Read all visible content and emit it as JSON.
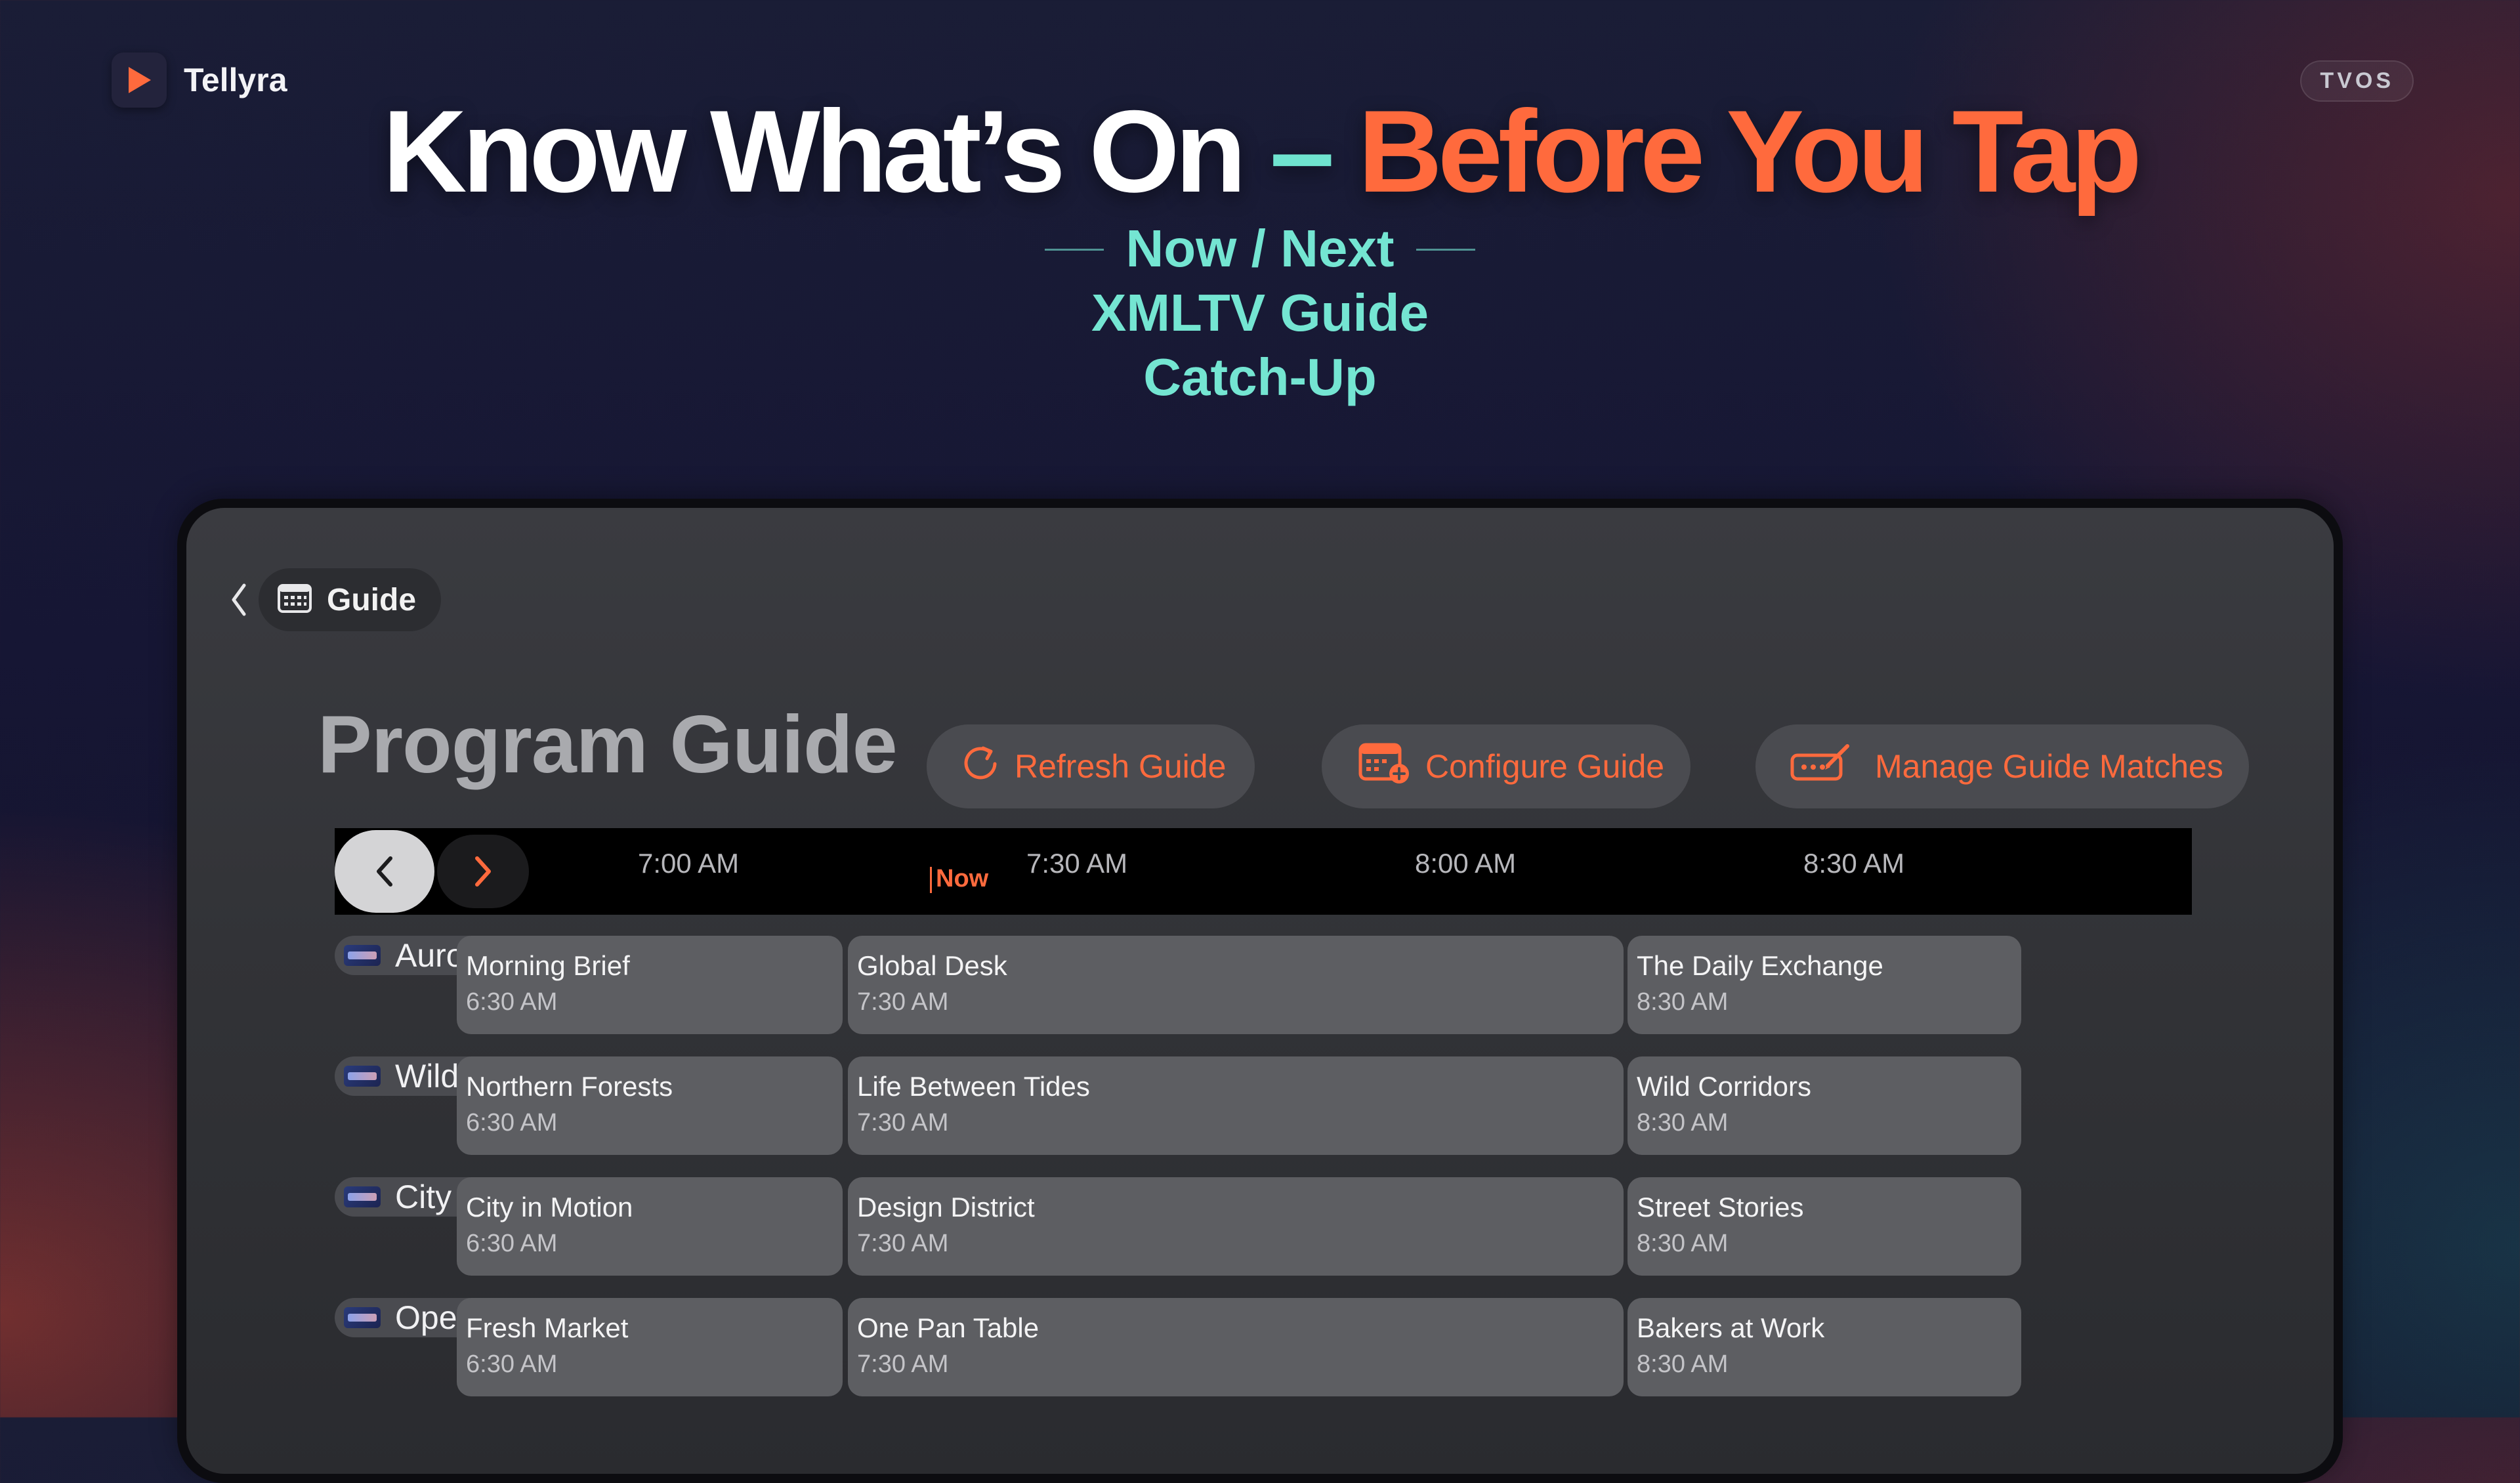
{
  "brand": {
    "name": "Tellyra",
    "badge": "TVOS"
  },
  "headline": {
    "part1": "Know What’s On",
    "dash": "–",
    "part2": "Before You Tap"
  },
  "features": [
    "Now / Next",
    "XMLTV Guide",
    "Catch-Up"
  ],
  "screen": {
    "back_label": "Guide",
    "title": "Program Guide",
    "actions": {
      "refresh": "Refresh Guide",
      "configure": "Configure Guide",
      "manage": "Manage Guide Matches"
    },
    "timeline": {
      "ticks": [
        "7:00 AM",
        "7:30 AM",
        "8:00 AM",
        "8:30 AM"
      ],
      "now_label": "Now"
    },
    "channels": [
      {
        "name": "Aurora News",
        "programs": [
          {
            "title": "Morning Brief",
            "time": "6:30 AM"
          },
          {
            "title": "Global Desk",
            "time": "7:30 AM"
          },
          {
            "title": "The Daily Exchange",
            "time": "8:30 AM"
          }
        ]
      },
      {
        "name": "Wild Earth",
        "programs": [
          {
            "title": "Northern Forests",
            "time": "6:30 AM"
          },
          {
            "title": "Life Between Tides",
            "time": "7:30 AM"
          },
          {
            "title": "Wild Corridors",
            "time": "8:30 AM"
          }
        ]
      },
      {
        "name": "City Pulse",
        "programs": [
          {
            "title": "City in Motion",
            "time": "6:30 AM"
          },
          {
            "title": "Design District",
            "time": "7:30 AM"
          },
          {
            "title": "Street Stories",
            "time": "8:30 AM"
          }
        ]
      },
      {
        "name": "Open Kitchen",
        "programs": [
          {
            "title": "Fresh Market",
            "time": "6:30 AM"
          },
          {
            "title": "One Pan Table",
            "time": "7:30 AM"
          },
          {
            "title": "Bakers at Work",
            "time": "8:30 AM"
          }
        ]
      }
    ]
  },
  "colors": {
    "accent": "#ff6a3d",
    "feature": "#74e5d2",
    "program_cell": "#5d5e62"
  },
  "icons": {
    "brand": "play-icon",
    "back": "chevron-left-icon",
    "guide": "calendar-grid-icon",
    "refresh": "refresh-icon",
    "configure": "calendar-add-icon",
    "manage": "edit-match-icon",
    "prev": "chevron-left-icon",
    "next": "chevron-right-icon",
    "channel_logo": "channel-logo-icon"
  }
}
